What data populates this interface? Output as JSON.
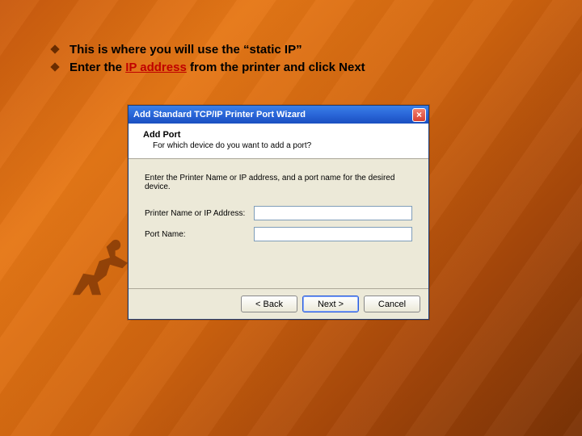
{
  "slide": {
    "bullet1": "This is where you will use the “static IP”",
    "bullet2_prefix": "Enter the ",
    "bullet2_emph": "IP address",
    "bullet2_suffix": " from the printer and click Next"
  },
  "dialog": {
    "title": "Add Standard TCP/IP Printer Port Wizard",
    "header_title": "Add Port",
    "header_sub": "For which device do you want to add a port?",
    "instruction": "Enter the Printer Name or IP address, and a port name for the desired device.",
    "field1_label": "Printer Name or IP Address:",
    "field1_value": "",
    "field2_label": "Port Name:",
    "field2_value": "",
    "btn_back": "< Back",
    "btn_next": "Next >",
    "btn_cancel": "Cancel"
  }
}
